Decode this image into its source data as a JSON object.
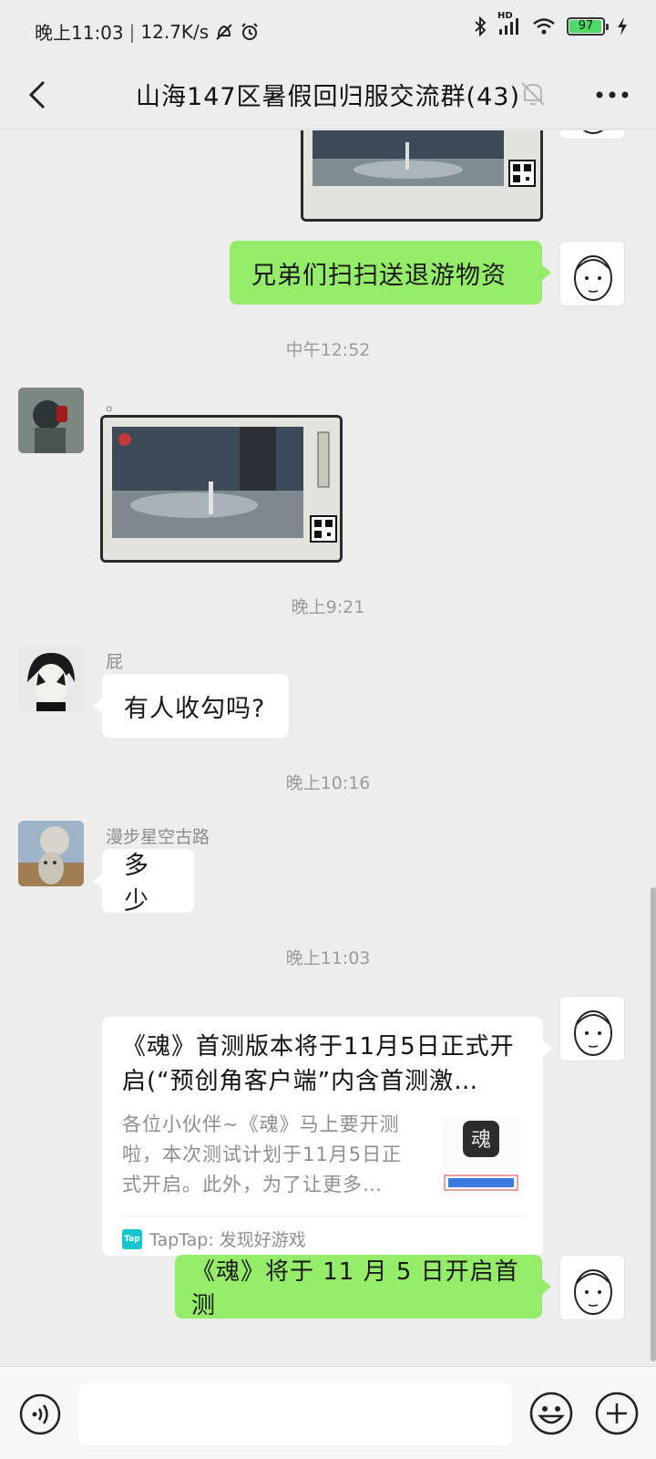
{
  "status_bar": {
    "time": "晚上11:03",
    "separator": "|",
    "net_speed": "12.7K/s",
    "network_badge": "HD",
    "battery": "97",
    "battery_level": 0.97,
    "icons": [
      "mute-alarm-icon",
      "alarm-icon",
      "bluetooth-icon",
      "signal-icon",
      "wifi-icon",
      "battery-icon",
      "charging-icon"
    ]
  },
  "header": {
    "title": "山海147区暑假回归服交流群(43)",
    "icons": [
      "back-icon",
      "mute-bell-icon",
      "more-icon"
    ]
  },
  "messages": {
    "m1_text": "兄弟们扫扫送退游物资",
    "t1": "中午12:52",
    "m2_text": "。",
    "t2": "晚上9:21",
    "m3_sender": "屁",
    "m3_text": "有人收勾吗?",
    "t3": "晚上10:16",
    "m4_sender": "漫步星空古路",
    "m4_text": "多少",
    "t4": "晚上11:03",
    "link": {
      "title": "《魂》首测版本将于11月5日正式开启(“预创角客户端”内含首测激…",
      "desc": "各位小伙伴~《魂》马上要开测啦，本次测试计划于11月5日正式开启。此外，为了让更多…",
      "thumb_glyph": "魂",
      "source_logo": "Tap",
      "source": "TapTap: 发现好游戏"
    },
    "m6_text": "《魂》将于 11 月 5 日开启首测"
  },
  "input": {
    "value": ""
  },
  "colors": {
    "self_bubble": "#95ec69",
    "other_bubble": "#ffffff",
    "background": "#ededed",
    "battery_fill": "#4cd964"
  }
}
